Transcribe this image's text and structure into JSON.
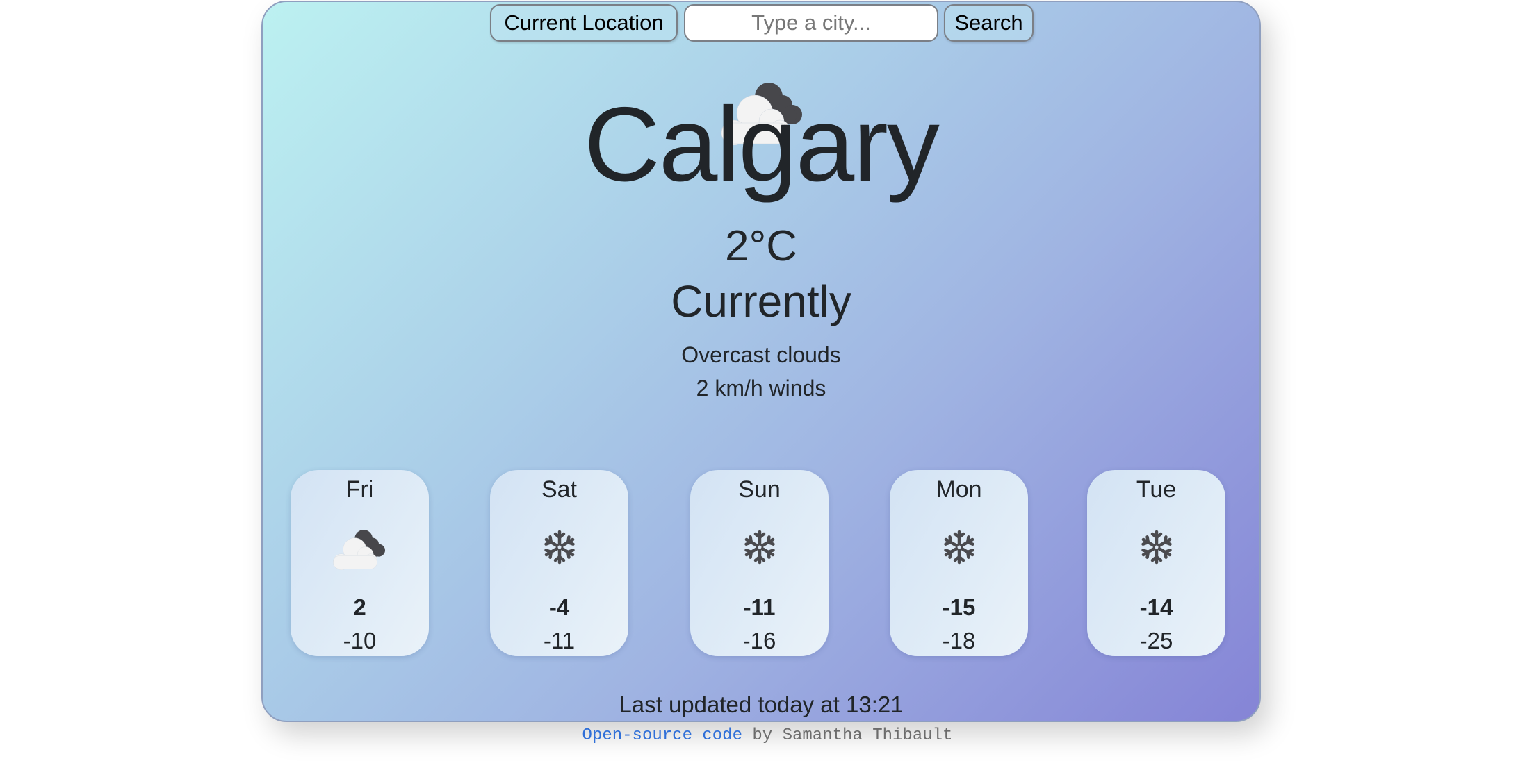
{
  "search": {
    "current_location_label": "Current Location",
    "city_placeholder": "Type a city...",
    "city_value": "",
    "search_label": "Search"
  },
  "current": {
    "icon": "overcast-clouds-icon",
    "city": "Calgary",
    "temperature": "2°C",
    "label": "Currently",
    "description": "Overcast clouds",
    "wind": "2 km/h winds"
  },
  "forecast": [
    {
      "day": "Fri",
      "icon": "overcast-clouds-icon",
      "high": "2",
      "low": "-10"
    },
    {
      "day": "Sat",
      "icon": "snowflake-icon",
      "high": "-4",
      "low": "-11"
    },
    {
      "day": "Sun",
      "icon": "snowflake-icon",
      "high": "-11",
      "low": "-16"
    },
    {
      "day": "Mon",
      "icon": "snowflake-icon",
      "high": "-15",
      "low": "-18"
    },
    {
      "day": "Tue",
      "icon": "snowflake-icon",
      "high": "-14",
      "low": "-25"
    }
  ],
  "last_updated": "Last updated today at 13:21",
  "footer": {
    "link_label": "Open-source code",
    "credit": " by Samantha Thibault"
  },
  "colors": {
    "gradient_start": "#bcf1f1",
    "gradient_end": "#8584d6",
    "link": "#2f6fd8",
    "text": "#212529"
  }
}
